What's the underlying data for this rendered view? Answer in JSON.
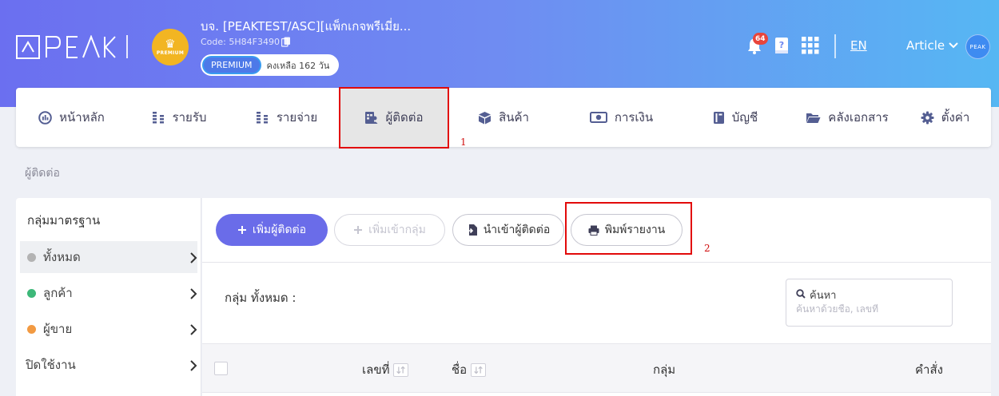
{
  "header": {
    "brand": "PEAK",
    "company": {
      "badge_text": "PREMIUM",
      "name": "บจ. [PEAKTEST/ASC][แพ็กเกจพรีเมี่ย...",
      "code": "Code: 5H84F3490",
      "plan": "PREMIUM",
      "remaining": "คงเหลือ 162 วัน"
    },
    "notifications_count": "64",
    "language": "EN",
    "user_name": "Article",
    "avatar_text": "PEAK"
  },
  "nav": {
    "items": [
      {
        "label": "หน้าหลัก",
        "icon": "dashboard-icon"
      },
      {
        "label": "รายรับ",
        "icon": "coins-icon"
      },
      {
        "label": "รายจ่าย",
        "icon": "coins-icon"
      },
      {
        "label": "ผู้ติดต่อ",
        "icon": "contacts-icon",
        "active": true
      },
      {
        "label": "สินค้า",
        "icon": "box-icon"
      },
      {
        "label": "การเงิน",
        "icon": "money-icon"
      },
      {
        "label": "บัญชี",
        "icon": "ledger-icon"
      },
      {
        "label": "คลังเอกสาร",
        "icon": "folder-icon"
      },
      {
        "label": "ตั้งค่า",
        "icon": "gear-icon"
      }
    ],
    "annotation_1": "1",
    "annotation_2": "2"
  },
  "breadcrumb": "ผู้ติดต่อ",
  "sidebar": {
    "title": "กลุ่มมาตรฐาน",
    "items": [
      {
        "label": "ทั้งหมด",
        "dot_color": "#b3b3b3"
      },
      {
        "label": "ลูกค้า",
        "dot_color": "#3db879"
      },
      {
        "label": "ผู้ขาย",
        "dot_color": "#f29a42"
      },
      {
        "label": "ปิดใช้งาน"
      }
    ]
  },
  "toolbar": {
    "add_contact": "เพิ่มผู้ติดต่อ",
    "add_to_group": "เพิ่มเข้ากลุ่ม",
    "import_contacts": "นำเข้าผู้ติดต่อ",
    "print_report": "พิมพ์รายงาน"
  },
  "content": {
    "group_label": "กลุ่ม ทั้งหมด :",
    "search_label": "ค้นหา",
    "search_placeholder": "ค้นหาด้วยชื่อ, เลขที่"
  },
  "table": {
    "columns": [
      "เลขที่",
      "ชื่อ",
      "กลุ่ม",
      "คำสั่ง"
    ]
  },
  "colors": {
    "primary": "#6a6ce9",
    "annotation_red": "#e20a0a",
    "header_gradient_start": "#6b6ff0",
    "header_gradient_end": "#56b7f3"
  }
}
